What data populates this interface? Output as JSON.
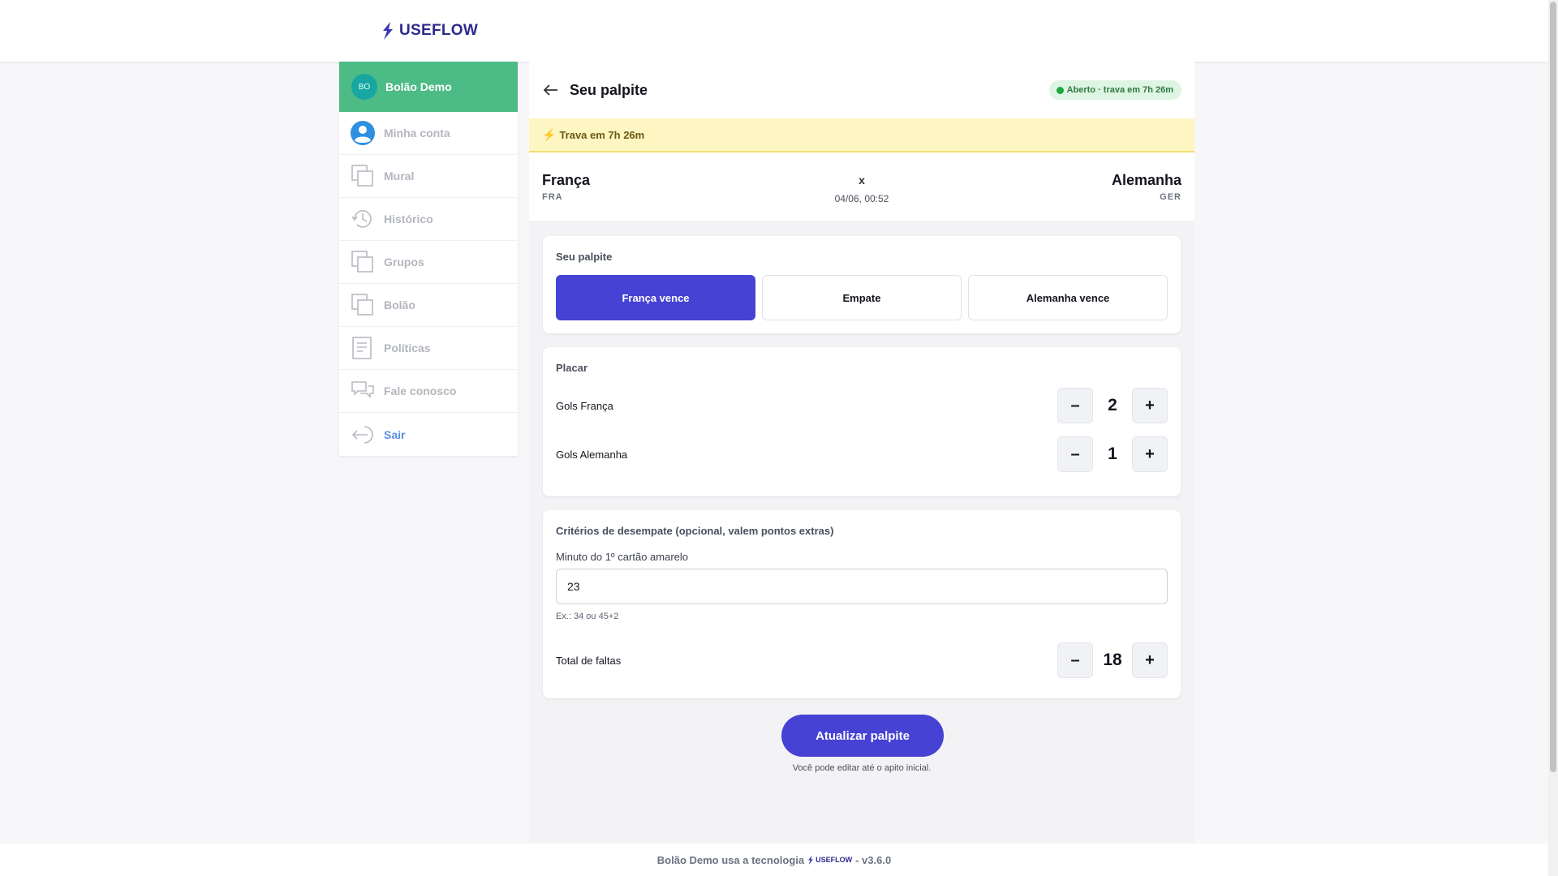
{
  "brand": {
    "name": "USEFLOW",
    "color": "#2e2a8c",
    "icon": "useflow-bolt-icon"
  },
  "sidebar": {
    "header": {
      "avatar": "BO",
      "title": "Bolão Demo",
      "color": "#4dbb86"
    },
    "items": [
      {
        "label": "Minha conta",
        "icon": "user-avatar-icon"
      },
      {
        "label": "Mural",
        "icon": "stacked-pages-icon"
      },
      {
        "label": "Histórico",
        "icon": "history-clock-icon"
      },
      {
        "label": "Grupos",
        "icon": "stacked-pages-icon"
      },
      {
        "label": "Bolão",
        "icon": "stacked-pages-icon"
      },
      {
        "label": "Políticas",
        "icon": "document-icon"
      },
      {
        "label": "Fale conosco",
        "icon": "chat-bubbles-icon"
      },
      {
        "label": "Sair",
        "icon": "logout-icon"
      }
    ]
  },
  "page": {
    "title": "Seu palpite",
    "status": "Aberto · trava em 7h 26m",
    "lock_notice": "Trava em 7h 26m"
  },
  "match": {
    "home": {
      "name": "França",
      "code": "FRA"
    },
    "away": {
      "name": "Alemanha",
      "code": "GER"
    },
    "separator": "x",
    "kickoff": "04/06, 00:52"
  },
  "pick": {
    "title": "Seu palpite",
    "options": [
      "França vence",
      "Empate",
      "Alemanha vence"
    ],
    "selected": "França vence"
  },
  "score": {
    "title": "Placar",
    "home_label": "Gols França",
    "home_value": "2",
    "away_label": "Gols Alemanha",
    "away_value": "1"
  },
  "tiebreak": {
    "title": "Critérios de desempate (opcional, valem pontos extras)",
    "card_label": "Minuto do 1º cartão amarelo",
    "card_value": "23",
    "card_hint": "Ex.: 34 ou 45+2",
    "fouls_label": "Total de faltas",
    "fouls_value": "18"
  },
  "stepper": {
    "minus": "–",
    "plus": "+"
  },
  "submit": {
    "label": "Atualizar palpite",
    "hint": "Você pode editar até o apito inicial."
  },
  "footer": {
    "prefix": "Bolão Demo usa a tecnologia",
    "brand": "USEFLOW",
    "version": "- v3.6.0"
  },
  "colors": {
    "primary": "#4642d4",
    "status_green": "#1fa83e",
    "warning_bg": "#fdf6c3"
  }
}
